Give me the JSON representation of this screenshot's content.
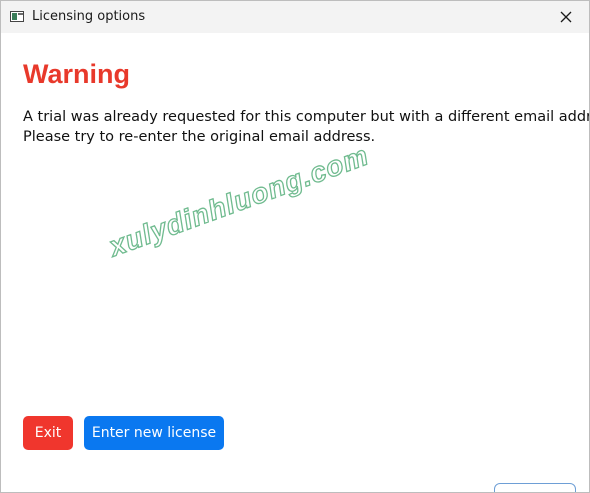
{
  "window": {
    "title": "Licensing options"
  },
  "content": {
    "heading": "Warning",
    "message_line1": "A trial was already requested for this computer but with a different email address.",
    "message_line2": "Please try to re-enter the original email address."
  },
  "watermark": {
    "text": "xulydinhluong.com"
  },
  "buttons": {
    "exit_label": "Exit",
    "new_license_label": "Enter new license"
  },
  "colors": {
    "heading": "#e8392b",
    "exit_button": "#f0362d",
    "license_button": "#0a78f0",
    "watermark_outline": "#69b88a"
  },
  "icons": {
    "app": "app-window-icon",
    "close": "close-icon"
  }
}
